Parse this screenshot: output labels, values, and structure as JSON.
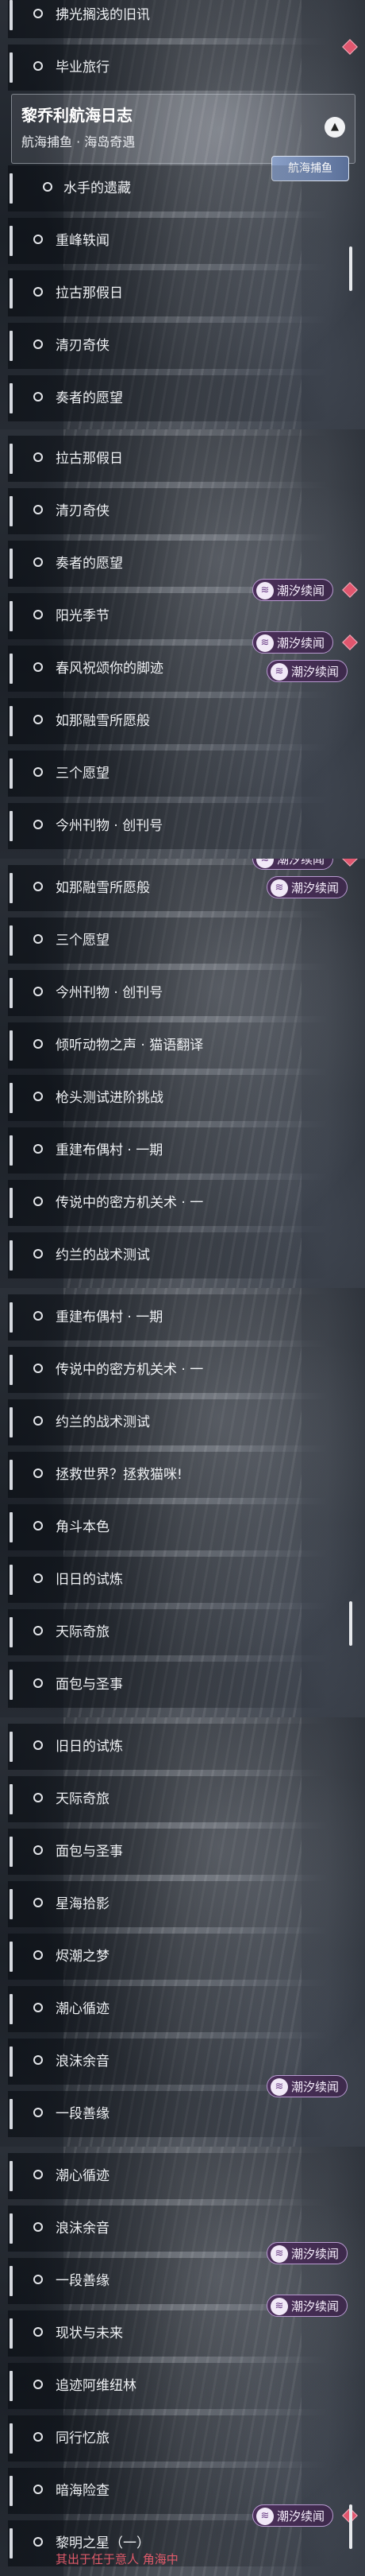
{
  "header": {
    "title": "黎乔利航海日志",
    "subtitle": "航海捕鱼 · 海岛奇遇",
    "tag": "航海捕鱼"
  },
  "badge_text": "潮汐续闻",
  "sections": [
    {
      "rows": [
        {
          "label": "拂光搁浅的旧讯"
        },
        {
          "label": "毕业旅行"
        },
        {
          "label": "水手的遗藏"
        },
        {
          "label": "重峰轶闻"
        },
        {
          "label": "拉古那假日"
        },
        {
          "label": "清刃奇侠"
        },
        {
          "label": "奏者的愿望"
        }
      ]
    },
    {
      "rows": [
        {
          "label": "拉古那假日"
        },
        {
          "label": "清刃奇侠"
        },
        {
          "label": "奏者的愿望"
        },
        {
          "label": "阳光季节",
          "badge": true,
          "dot": true
        },
        {
          "label": "春风祝颂你的脚迹",
          "badge": true,
          "dot": true
        },
        {
          "label": "如那融雪所愿般",
          "badge": true
        },
        {
          "label": "三个愿望"
        },
        {
          "label": "今州刊物 · 创刊号"
        }
      ]
    },
    {
      "rows": [
        {
          "label": "如那融雪所愿般",
          "badge": true,
          "dot": true
        },
        {
          "label": "三个愿望",
          "badge": true
        },
        {
          "label": "今州刊物 · 创刊号"
        },
        {
          "label": "倾听动物之声 · 猫语翻译"
        },
        {
          "label": "枪头测试进阶挑战"
        },
        {
          "label": "重建布偶村 · 一期"
        },
        {
          "label": "传说中的密方机关术 · 一"
        },
        {
          "label": "约兰的战术测试"
        }
      ]
    },
    {
      "rows": [
        {
          "label": "重建布偶村 · 一期"
        },
        {
          "label": "传说中的密方机关术 · 一"
        },
        {
          "label": "约兰的战术测试"
        },
        {
          "label": "拯救世界？拯救猫咪!"
        },
        {
          "label": "角斗本色"
        },
        {
          "label": "旧日的试炼"
        },
        {
          "label": "天际奇旅"
        },
        {
          "label": "面包与圣事"
        }
      ]
    },
    {
      "rows": [
        {
          "label": "旧日的试炼"
        },
        {
          "label": "天际奇旅"
        },
        {
          "label": "面包与圣事"
        },
        {
          "label": "星海拾影"
        },
        {
          "label": "烬潮之梦"
        },
        {
          "label": "潮心循迹"
        },
        {
          "label": "浪沫余音"
        },
        {
          "label": "一段善缘",
          "badge": true
        }
      ]
    },
    {
      "rows": [
        {
          "label": "潮心循迹"
        },
        {
          "label": "浪沫余音"
        },
        {
          "label": "一段善缘",
          "badge": true
        },
        {
          "label": "现状与未来",
          "badge": true
        },
        {
          "label": "追迹阿维纽林"
        },
        {
          "label": "同行忆旅"
        },
        {
          "label": "暗海险查"
        },
        {
          "label": "黎明之星（一）",
          "badge": true,
          "dot": true
        }
      ]
    }
  ],
  "footer_note": "其出于任于意人 角海中"
}
